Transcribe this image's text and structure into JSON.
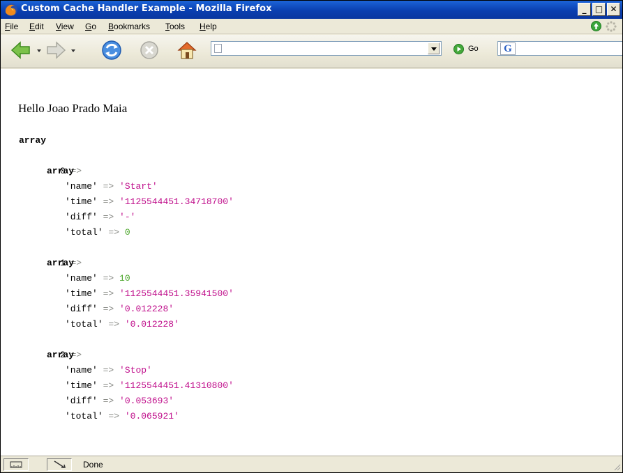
{
  "window": {
    "title": "Custom Cache Handler Example - Mozilla Firefox",
    "controls": {
      "minimize": "_",
      "maximize": "□",
      "close": "✕"
    }
  },
  "menu": [
    {
      "first": "F",
      "rest": "ile"
    },
    {
      "first": "E",
      "rest": "dit"
    },
    {
      "first": "V",
      "rest": "iew"
    },
    {
      "first": "G",
      "rest": "o"
    },
    {
      "first": "B",
      "rest": "ookmarks"
    },
    {
      "first": "T",
      "rest": "ools"
    },
    {
      "first": "H",
      "rest": "elp"
    }
  ],
  "toolbar": {
    "url_value": "",
    "go_label": "Go",
    "search_engine_letter": "G",
    "search_value": ""
  },
  "page": {
    "greeting": "Hello Joao Prado Maia",
    "dump": {
      "root_keyword": "array",
      "entries": [
        {
          "index": "0",
          "keyword": "array",
          "fields": [
            {
              "key": "'name'",
              "value": "'Start'",
              "kind": "str"
            },
            {
              "key": "'time'",
              "value": "'1125544451.34718700'",
              "kind": "str"
            },
            {
              "key": "'diff'",
              "value": "'-'",
              "kind": "str"
            },
            {
              "key": "'total'",
              "value": "0",
              "kind": "num"
            }
          ]
        },
        {
          "index": "1",
          "keyword": "array",
          "fields": [
            {
              "key": "'name'",
              "value": "10",
              "kind": "num"
            },
            {
              "key": "'time'",
              "value": "'1125544451.35941500'",
              "kind": "str"
            },
            {
              "key": "'diff'",
              "value": "'0.012228'",
              "kind": "str"
            },
            {
              "key": "'total'",
              "value": "'0.012228'",
              "kind": "str"
            }
          ]
        },
        {
          "index": "2",
          "keyword": "array",
          "fields": [
            {
              "key": "'name'",
              "value": "'Stop'",
              "kind": "str"
            },
            {
              "key": "'time'",
              "value": "'1125544451.41310800'",
              "kind": "str"
            },
            {
              "key": "'diff'",
              "value": "'0.053693'",
              "kind": "str"
            },
            {
              "key": "'total'",
              "value": "'0.065921'",
              "kind": "str"
            }
          ]
        }
      ],
      "arrow": "=>"
    }
  },
  "status": {
    "text": "Done"
  },
  "colors": {
    "string_value": "#c0108c",
    "number_value": "#4ca62b",
    "operator": "#888a85",
    "titlebar": "#0a3fb0"
  }
}
